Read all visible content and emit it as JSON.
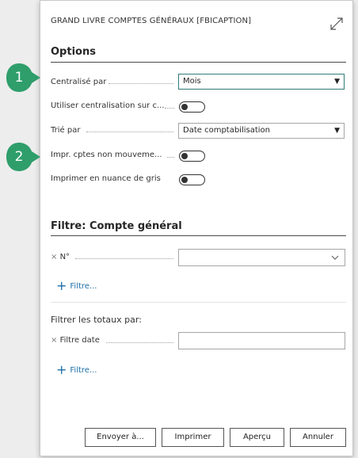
{
  "dialog": {
    "title": "GRAND LIVRE COMPTES GÉNÉRAUX [FBICAPTION]"
  },
  "options": {
    "heading": "Options",
    "centralise_label": "Centralisé par",
    "centralise_value": "Mois",
    "utiliser_label": "Utiliser centralisation sur c...",
    "trie_label": "Trié par",
    "trie_value": "Date comptabilisation",
    "impr_label": "Impr. cptes non mouveme...",
    "gris_label": "Imprimer en nuance de gris"
  },
  "filtre": {
    "heading": "Filtre: Compte général",
    "no_label": "N°",
    "add_link": "Filtre..."
  },
  "totaux": {
    "heading": "Filtrer les totaux par:",
    "date_label": "Filtre date",
    "add_link": "Filtre..."
  },
  "buttons": {
    "envoyer": "Envoyer à...",
    "imprimer": "Imprimer",
    "apercu": "Aperçu",
    "annuler": "Annuler"
  },
  "callouts": {
    "first": "1",
    "second": "2"
  },
  "colors": {
    "callout": "#2f9e6b",
    "link": "#1b6ea8",
    "focus_border": "#2f7d78"
  }
}
